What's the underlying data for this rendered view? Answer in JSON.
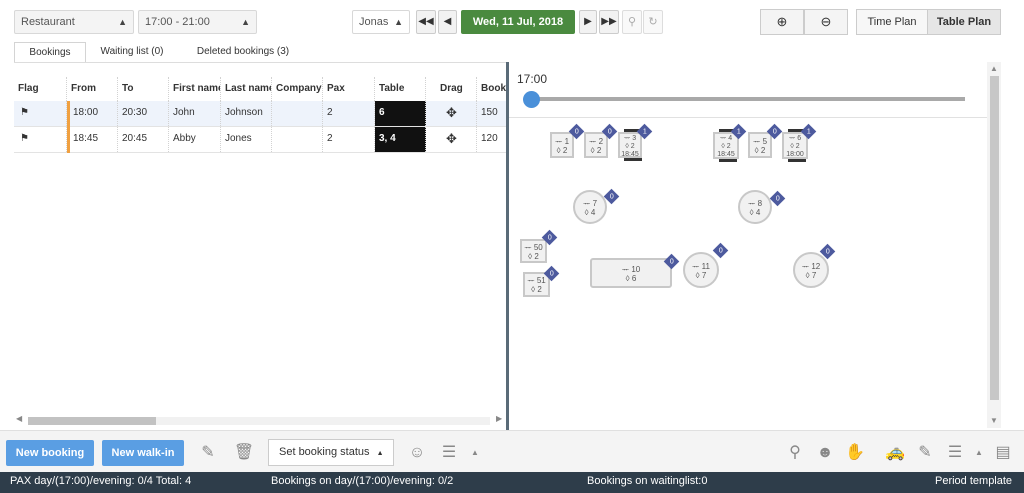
{
  "toolbar": {
    "area_select": "Restaurant",
    "time_select": "17:00 - 21:00",
    "user_select": "Jonas",
    "date_label": "Wed, 11 Jul, 2018",
    "time_plan_label": "Time Plan",
    "table_plan_label": "Table Plan"
  },
  "tabs": [
    {
      "label": "Bookings"
    },
    {
      "label": "Waiting list (0)"
    },
    {
      "label": "Deleted bookings (3)"
    }
  ],
  "bookings": {
    "columns": [
      "Flag",
      "From",
      "To",
      "First name",
      "Last name",
      "Company",
      "Pax",
      "Table",
      "Drag",
      "Book"
    ],
    "rows": [
      {
        "from": "18:00",
        "to": "20:30",
        "first": "John",
        "last": "Johnson",
        "company": "",
        "pax": "2",
        "table": "6",
        "book": "150"
      },
      {
        "from": "18:45",
        "to": "20:45",
        "first": "Abby",
        "last": "Jones",
        "company": "",
        "pax": "2",
        "table": "3, 4",
        "book": "120"
      }
    ]
  },
  "plan": {
    "time_label": "17:00",
    "slider_fraction": 0.0,
    "tables": [
      {
        "id": "t1",
        "num": "1",
        "pax": "2",
        "time": "",
        "badge": "0"
      },
      {
        "id": "t2",
        "num": "2",
        "pax": "2",
        "time": "",
        "badge": "0"
      },
      {
        "id": "t3",
        "num": "3",
        "pax": "2",
        "time": "18:45",
        "badge": "1"
      },
      {
        "id": "t4",
        "num": "4",
        "pax": "2",
        "time": "18:45",
        "badge": "1"
      },
      {
        "id": "t5",
        "num": "5",
        "pax": "2",
        "time": "",
        "badge": "0"
      },
      {
        "id": "t6",
        "num": "6",
        "pax": "2",
        "time": "18:00",
        "badge": "1"
      },
      {
        "id": "t7",
        "num": "7",
        "pax": "4",
        "time": "",
        "badge": "0"
      },
      {
        "id": "t8",
        "num": "8",
        "pax": "4",
        "time": "",
        "badge": "0"
      },
      {
        "id": "t50",
        "num": "50",
        "pax": "2",
        "time": "",
        "badge": "0"
      },
      {
        "id": "t51",
        "num": "51",
        "pax": "2",
        "time": "",
        "badge": "0"
      },
      {
        "id": "t10",
        "num": "10",
        "pax": "6",
        "time": "",
        "badge": "0"
      },
      {
        "id": "t11",
        "num": "11",
        "pax": "7",
        "time": "",
        "badge": "0"
      },
      {
        "id": "t12",
        "num": "12",
        "pax": "7",
        "time": "",
        "badge": "0"
      }
    ]
  },
  "actions": {
    "new_booking": "New booking",
    "new_walkin": "New walk-in",
    "set_status": "Set booking status"
  },
  "status": {
    "pax": "PAX day/(17:00)/evening: 0/4 Total: 4",
    "bookings": "Bookings on day/(17:00)/evening: 0/2",
    "waitinglist": "Bookings on waitinglist:0",
    "period": "Period template"
  },
  "icons": {
    "table_symbol": "ᅲ",
    "pax_symbol": "◊"
  }
}
